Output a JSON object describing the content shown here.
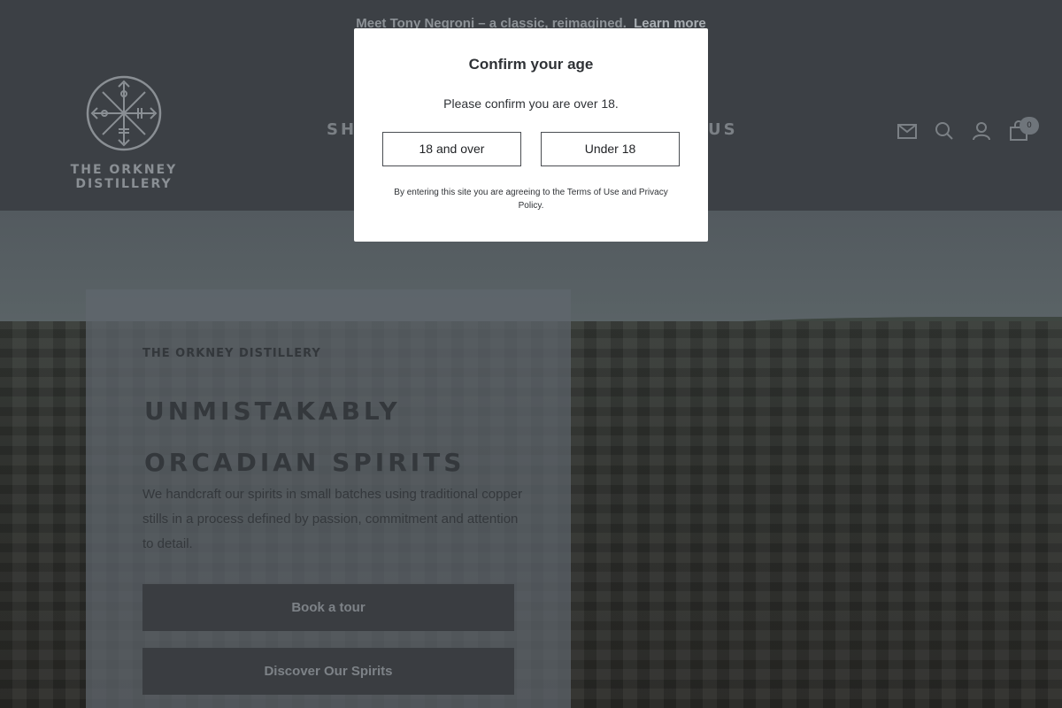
{
  "announcement": {
    "text": "Meet Tony Negroni – a classic, reimagined.",
    "link": "Learn more"
  },
  "brand": {
    "name": "THE ORKNEY DISTILLERY",
    "logo_icon": "vegvisir-compass-icon"
  },
  "nav": {
    "items": [
      "SHOP",
      "US"
    ]
  },
  "header_icons": [
    "mail-icon",
    "search-icon",
    "account-icon",
    "cart-icon"
  ],
  "cart": {
    "count": "0"
  },
  "hero": {
    "eyebrow": "THE ORKNEY DISTILLERY",
    "headline": "UNMISTAKABLY ORCADIAN SPIRITS",
    "intro": "We handcraft our spirits in small batches using traditional copper stills in a process defined by passion, commitment and attention to detail.",
    "buttons": [
      "Book a tour",
      "Discover Our Spirits"
    ]
  },
  "age_modal": {
    "title": "Confirm your age",
    "subtitle": "Please confirm you are over 18.",
    "confirm_label": "18 and over",
    "deny_label": "Under 18",
    "note": "By entering this site you are agreeing to the Terms of Use and Privacy Policy."
  },
  "colors": {
    "overlay": "#3c4045",
    "modal_bg": "#ffffff",
    "button_border": "#4a4d52"
  }
}
